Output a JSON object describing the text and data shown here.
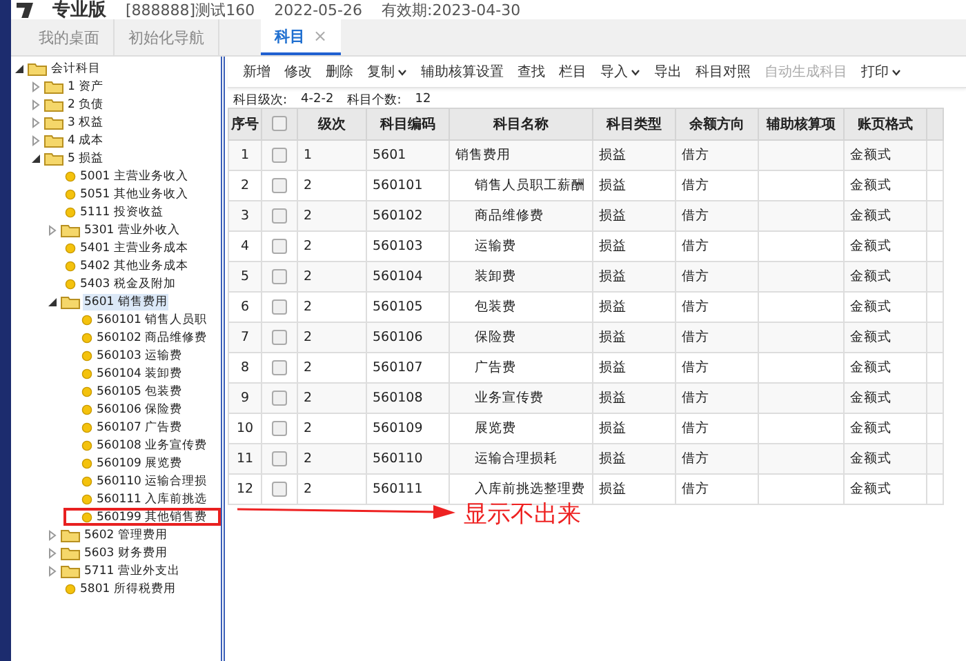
{
  "header": {
    "product": "专业版",
    "account": "[888888]测试160",
    "date": "2022-05-26",
    "validity": "有效期:2023-04-30"
  },
  "tabs": [
    {
      "label": "我的桌面",
      "selected": false,
      "closable": false
    },
    {
      "label": "初始化导航",
      "selected": false,
      "closable": false
    },
    {
      "label": "科目",
      "selected": true,
      "closable": true,
      "close": "×"
    }
  ],
  "tree": [
    {
      "label": "会计科目",
      "kind": "folder",
      "expanded": true,
      "selected": false,
      "children": [
        {
          "label": "1 资产",
          "kind": "folder",
          "expanded": false,
          "selected": false
        },
        {
          "label": "2 负债",
          "kind": "folder",
          "expanded": false,
          "selected": false
        },
        {
          "label": "3 权益",
          "kind": "folder",
          "expanded": false,
          "selected": false
        },
        {
          "label": "4 成本",
          "kind": "folder",
          "expanded": false,
          "selected": false
        },
        {
          "label": "5 损益",
          "kind": "folder",
          "expanded": true,
          "selected": false,
          "children": [
            {
              "label": "5001 主营业务收入",
              "kind": "leaf",
              "selected": false
            },
            {
              "label": "5051 其他业务收入",
              "kind": "leaf",
              "selected": false
            },
            {
              "label": "5111 投资收益",
              "kind": "leaf",
              "selected": false
            },
            {
              "label": "5301 营业外收入",
              "kind": "folder",
              "expanded": false,
              "selected": false
            },
            {
              "label": "5401 主营业务成本",
              "kind": "leaf",
              "selected": false
            },
            {
              "label": "5402 其他业务成本",
              "kind": "leaf",
              "selected": false
            },
            {
              "label": "5403 税金及附加",
              "kind": "leaf",
              "selected": false
            },
            {
              "label": "5601 销售费用",
              "kind": "folder",
              "expanded": true,
              "selected": true,
              "children": [
                {
                  "label": "560101 销售人员职",
                  "kind": "leaf",
                  "selected": false
                },
                {
                  "label": "560102 商品维修费",
                  "kind": "leaf",
                  "selected": false
                },
                {
                  "label": "560103 运输费",
                  "kind": "leaf",
                  "selected": false
                },
                {
                  "label": "560104 装卸费",
                  "kind": "leaf",
                  "selected": false
                },
                {
                  "label": "560105 包装费",
                  "kind": "leaf",
                  "selected": false
                },
                {
                  "label": "560106 保险费",
                  "kind": "leaf",
                  "selected": false
                },
                {
                  "label": "560107 广告费",
                  "kind": "leaf",
                  "selected": false
                },
                {
                  "label": "560108 业务宣传费",
                  "kind": "leaf",
                  "selected": false
                },
                {
                  "label": "560109 展览费",
                  "kind": "leaf",
                  "selected": false
                },
                {
                  "label": "560110 运输合理损",
                  "kind": "leaf",
                  "selected": false
                },
                {
                  "label": "560111 入库前挑选",
                  "kind": "leaf",
                  "selected": false
                },
                {
                  "label": "560199 其他销售费",
                  "kind": "leaf",
                  "selected": false,
                  "annotated": true
                }
              ]
            },
            {
              "label": "5602 管理费用",
              "kind": "folder",
              "expanded": false,
              "selected": false
            },
            {
              "label": "5603 财务费用",
              "kind": "folder",
              "expanded": false,
              "selected": false
            },
            {
              "label": "5711 营业外支出",
              "kind": "folder",
              "expanded": false,
              "selected": false
            },
            {
              "label": "5801 所得税费用",
              "kind": "leaf",
              "selected": false
            }
          ]
        }
      ]
    }
  ],
  "toolbar": [
    {
      "label": "新增",
      "dropdown": false,
      "disabled": false
    },
    {
      "label": "修改",
      "dropdown": false,
      "disabled": false
    },
    {
      "label": "删除",
      "dropdown": false,
      "disabled": false
    },
    {
      "label": "复制",
      "dropdown": true,
      "disabled": false
    },
    {
      "label": "辅助核算设置",
      "dropdown": false,
      "disabled": false
    },
    {
      "label": "查找",
      "dropdown": false,
      "disabled": false
    },
    {
      "label": "栏目",
      "dropdown": false,
      "disabled": false
    },
    {
      "label": "导入",
      "dropdown": true,
      "disabled": false
    },
    {
      "label": "导出",
      "dropdown": false,
      "disabled": false
    },
    {
      "label": "科目对照",
      "dropdown": false,
      "disabled": false
    },
    {
      "label": "自动生成科目",
      "dropdown": false,
      "disabled": true
    },
    {
      "label": "打印",
      "dropdown": true,
      "disabled": false
    }
  ],
  "info": [
    {
      "label": "科目级次:",
      "value": "4-2-2"
    },
    {
      "label": "科目个数:",
      "value": "12"
    }
  ],
  "table": {
    "select_all_checked": false,
    "columns": [
      "序号",
      "级次",
      "科目编码",
      "科目名称",
      "科目类型",
      "余额方向",
      "辅助核算项",
      "账页格式"
    ],
    "rows": [
      {
        "no": "1",
        "checked": false,
        "level": "1",
        "code": "5601",
        "name": "销售费用",
        "indented": false,
        "type": "损益",
        "direction": "借方",
        "format": "金额式"
      },
      {
        "no": "2",
        "checked": false,
        "level": "2",
        "code": "560101",
        "name": "销售人员职工薪酬",
        "indented": true,
        "type": "损益",
        "direction": "借方",
        "format": "金额式"
      },
      {
        "no": "3",
        "checked": false,
        "level": "2",
        "code": "560102",
        "name": "商品维修费",
        "indented": true,
        "type": "损益",
        "direction": "借方",
        "format": "金额式"
      },
      {
        "no": "4",
        "checked": false,
        "level": "2",
        "code": "560103",
        "name": "运输费",
        "indented": true,
        "type": "损益",
        "direction": "借方",
        "format": "金额式"
      },
      {
        "no": "5",
        "checked": false,
        "level": "2",
        "code": "560104",
        "name": "装卸费",
        "indented": true,
        "type": "损益",
        "direction": "借方",
        "format": "金额式"
      },
      {
        "no": "6",
        "checked": false,
        "level": "2",
        "code": "560105",
        "name": "包装费",
        "indented": true,
        "type": "损益",
        "direction": "借方",
        "format": "金额式"
      },
      {
        "no": "7",
        "checked": false,
        "level": "2",
        "code": "560106",
        "name": "保险费",
        "indented": true,
        "type": "损益",
        "direction": "借方",
        "format": "金额式"
      },
      {
        "no": "8",
        "checked": false,
        "level": "2",
        "code": "560107",
        "name": "广告费",
        "indented": true,
        "type": "损益",
        "direction": "借方",
        "format": "金额式"
      },
      {
        "no": "9",
        "checked": false,
        "level": "2",
        "code": "560108",
        "name": "业务宣传费",
        "indented": true,
        "type": "损益",
        "direction": "借方",
        "format": "金额式"
      },
      {
        "no": "10",
        "checked": false,
        "level": "2",
        "code": "560109",
        "name": "展览费",
        "indented": true,
        "type": "损益",
        "direction": "借方",
        "format": "金额式"
      },
      {
        "no": "11",
        "checked": false,
        "level": "2",
        "code": "560110",
        "name": "运输合理损耗",
        "indented": true,
        "type": "损益",
        "direction": "借方",
        "format": "金额式"
      },
      {
        "no": "12",
        "checked": false,
        "level": "2",
        "code": "560111",
        "name": "入库前挑选整理费",
        "indented": true,
        "type": "损益",
        "direction": "借方",
        "format": "金额式"
      }
    ]
  },
  "annotation": {
    "text": "显示不出来"
  }
}
